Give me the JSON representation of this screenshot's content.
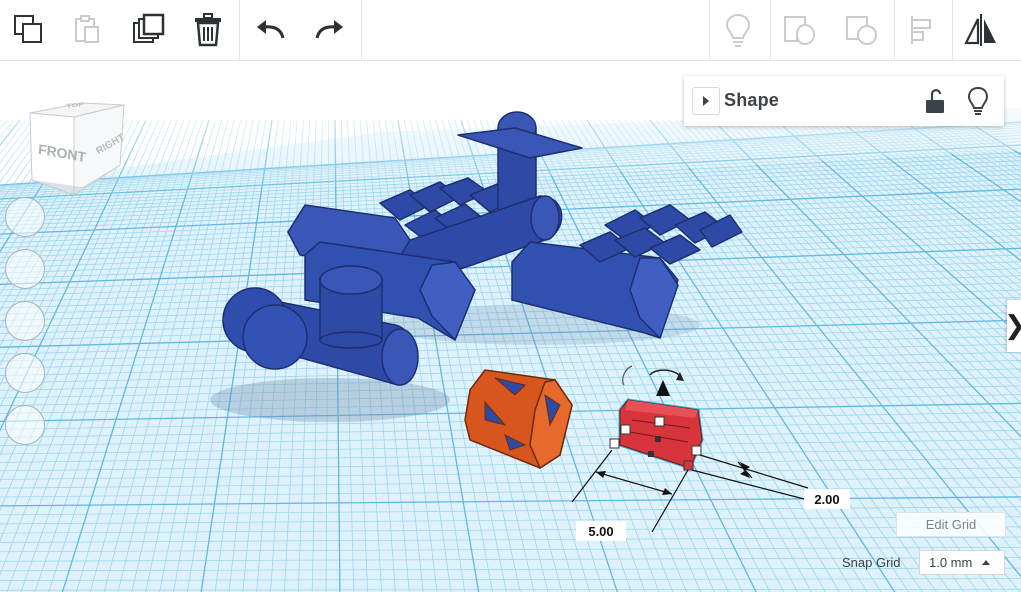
{
  "toolbar": {
    "left": [
      {
        "name": "copy-button",
        "icon": "copy-icon",
        "enabled": true
      },
      {
        "name": "paste-button",
        "icon": "paste-icon",
        "enabled": false
      },
      {
        "name": "duplicate-button",
        "icon": "duplicate-icon",
        "enabled": true
      },
      {
        "name": "delete-button",
        "icon": "trash-icon",
        "enabled": true
      },
      {
        "name": "undo-button",
        "icon": "undo-icon",
        "enabled": true
      },
      {
        "name": "redo-button",
        "icon": "redo-icon",
        "enabled": true
      }
    ],
    "right": [
      {
        "name": "show-all-button",
        "icon": "lightbulb-icon",
        "enabled": false
      },
      {
        "name": "group-button",
        "icon": "group-icon",
        "enabled": false
      },
      {
        "name": "ungroup-button",
        "icon": "ungroup-icon",
        "enabled": false
      },
      {
        "name": "align-button",
        "icon": "align-icon",
        "enabled": false
      },
      {
        "name": "mirror-button",
        "icon": "mirror-icon",
        "enabled": true
      }
    ]
  },
  "viewcube": {
    "top": "TOP",
    "front": "FRONT",
    "right": "RIGHT"
  },
  "inspector": {
    "title": "Shape",
    "lock_icon": "unlock-icon",
    "visibility_icon": "lightbulb-icon"
  },
  "dimensions": {
    "length": "5.00",
    "width": "2.00"
  },
  "grid": {
    "edit_label": "Edit Grid",
    "snap_label": "Snap Grid",
    "snap_value": "1.0 mm"
  },
  "colors": {
    "shape_blue": "#2e4aa6",
    "selected_red": "#d8343b",
    "orange": "#d6561e",
    "grid_line": "#8fd3ef",
    "selection": "#2bb6de"
  }
}
